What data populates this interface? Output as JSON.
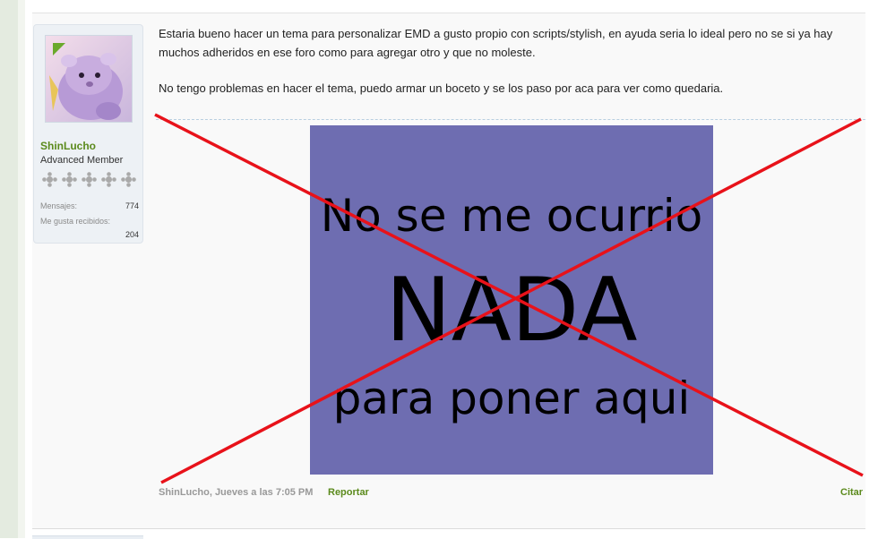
{
  "post": {
    "user": {
      "name": "ShinLucho",
      "title": "Advanced Member",
      "stats": {
        "messages_label": "Mensajes:",
        "messages_value": "774",
        "likes_label": "Me gusta recibidos:",
        "likes_value": "204"
      },
      "rank_stars": 5,
      "online": true
    },
    "message": {
      "paragraph1": "Estaria bueno hacer un tema para personalizar EMD a gusto propio con scripts/stylish, en ayuda seria lo ideal pero no se si ya hay muchos adheridos en ese foro como para agregar otro y que no moleste.",
      "paragraph2": "No tengo problemas en hacer el tema, puedo armar un boceto y se los paso por aca para ver como quedaria."
    },
    "signature": {
      "line1": "No se me ocurrio",
      "line2": "NADA",
      "line3": "para poner aqui",
      "background": "#6e6db1",
      "cross_color": "#e8121a"
    },
    "footer": {
      "author": "ShinLucho",
      "date": ", Jueves a las 7:05 PM",
      "report": "Reportar",
      "quote": "Citar"
    }
  },
  "colors": {
    "link_green": "#5b8a1c",
    "sidebar_strip": "#e4ebe0"
  }
}
